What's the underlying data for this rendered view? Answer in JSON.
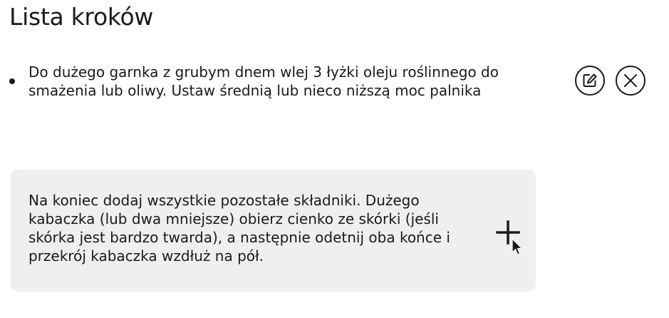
{
  "header": {
    "title": "Lista kroków"
  },
  "steps": [
    {
      "text": "Do dużego garnka z grubym dnem wlej 3 łyżki oleju roślinnego do smażenia lub oliwy. Ustaw średnią lub nieco niższą moc palnika",
      "edit_icon": "edit-icon",
      "delete_icon": "close-icon"
    }
  ],
  "new_step": {
    "text": "Na koniec dodaj wszystkie pozostałe składniki. Dużego kabaczka (lub dwa mniejsze) obierz cienko ze skórki (jeśli skórka jest bardzo twarda), a następnie odetnij oba końce i przekrój kabaczka wzdłuż na pół.",
    "add_icon": "plus-icon"
  },
  "colors": {
    "text": "#1a1a1a",
    "card_background": "#efefef",
    "background": "#ffffff"
  }
}
